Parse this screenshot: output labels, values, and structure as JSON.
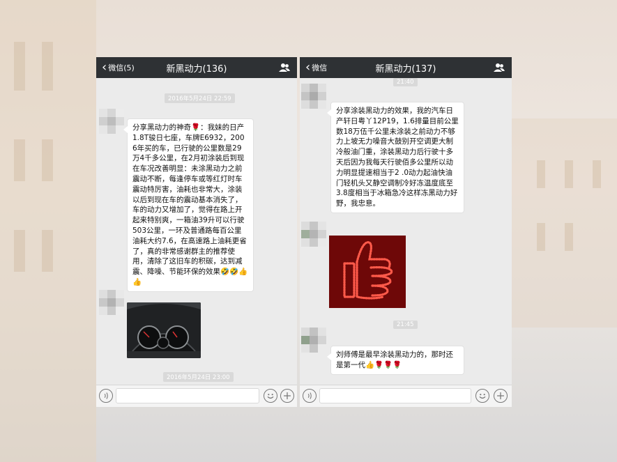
{
  "left_chat": {
    "nav": {
      "back_label": "微信(5)",
      "title": "新黑动力(136)"
    },
    "timestamp_1": "2016年5月24日 22:59",
    "message_1": "分享黑动力的神奇🌹：我妹的日产1.8T骏日七座，车牌E6932，2006年买的车，已行驶的公里数是29万4千多公里，在2月初涂装后到现在车况改善明显：未涂黑动力之前震动不断，每逢停车或等红灯时车震动特厉害，油耗也非常大，涂装以后到现在车的震动基本消失了，车的动力又增加了，觉得在路上开起来特别爽，一箱油39升可以行驶503公里，一环及普通路每百公里油耗大约7.6，在高速路上油耗更省了，真的非常感谢群主的推荐使用，清除了这旧车的积碳，达到减震、降噪、节能环保的效果🤣🤣👍👍",
    "timestamp_2": "2016年5月24日 23:00"
  },
  "right_chat": {
    "nav": {
      "back_label": "微信",
      "title": "新黑动力(137)"
    },
    "timestamp_top": "21:40",
    "message_1": "分享涂装黑动力的效果，我的汽车日产轩日粤丫12P19，1.6排量目前公里数18万伍千公里未涂装之前动力不够力上坡无力噪音大鼓别开空调更大制冷般油门重，涂装黑动力后行驶十多天后因为我每天行驶佰多公里所以动力明显提速相当于2 .0动力起油快油门轻机头又静空调制冷好冻温度底至3.8度相当于冰箱急冷这样冻黑动力好野，我忠意。",
    "timestamp_2": "21:45",
    "message_2": "刘师傅是最早涂装黑动力的，那时还是第一代👍🌹🌹🌹"
  },
  "icons": {
    "back": "chevron-left-icon",
    "group": "group-members-icon",
    "voice": "voice-icon",
    "emoji": "emoji-icon",
    "plus": "plus-icon"
  },
  "colors": {
    "nav_bg": "#2e3134",
    "chat_bg": "#ebebeb",
    "bubble": "#ffffff",
    "timestamp_bg": "#d9d9d9"
  }
}
